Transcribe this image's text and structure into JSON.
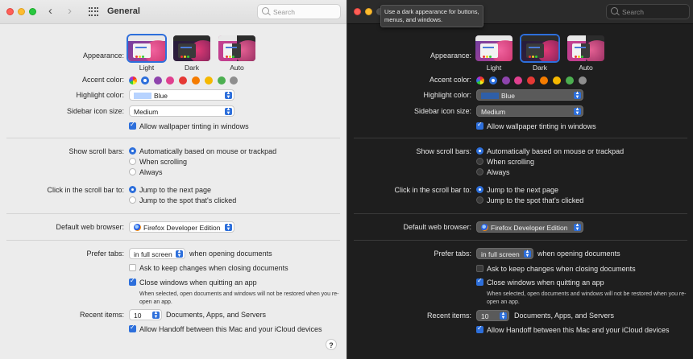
{
  "window": {
    "title": "General",
    "search_placeholder": "Search"
  },
  "tooltip": "Use a dark appearance for buttons, menus, and windows.",
  "appearance": {
    "label": "Appearance:",
    "options": [
      "Light",
      "Dark",
      "Auto"
    ],
    "light_selected": "Light",
    "dark_selected": "Dark"
  },
  "accent_color": {
    "label": "Accent color:",
    "colors": [
      "multicolor",
      "#2d6fdb",
      "#8e44ad",
      "#e0408f",
      "#e53935",
      "#f57c00",
      "#f5b800",
      "#4caf50",
      "#8e8e8e"
    ],
    "selected": "#2d6fdb"
  },
  "highlight_color": {
    "label": "Highlight color:",
    "value": "Blue"
  },
  "sidebar_icon_size": {
    "label": "Sidebar icon size:",
    "value": "Medium"
  },
  "wallpaper_tinting": {
    "label": "Allow wallpaper tinting in windows",
    "checked": true
  },
  "scroll_bars": {
    "label": "Show scroll bars:",
    "options": [
      "Automatically based on mouse or trackpad",
      "When scrolling",
      "Always"
    ],
    "selected": "Automatically based on mouse or trackpad"
  },
  "scroll_click": {
    "label": "Click in the scroll bar to:",
    "options": [
      "Jump to the next page",
      "Jump to the spot that's clicked"
    ],
    "selected": "Jump to the next page"
  },
  "default_browser": {
    "label": "Default web browser:",
    "value": "Firefox Developer Edition"
  },
  "prefer_tabs": {
    "label": "Prefer tabs:",
    "value": "in full screen",
    "suffix": "when opening documents"
  },
  "ask_keep_changes": {
    "label": "Ask to keep changes when closing documents",
    "checked": false
  },
  "close_windows": {
    "label": "Close windows when quitting an app",
    "checked": true,
    "note": "When selected, open documents and windows will not be restored when you re-open an app."
  },
  "recent_items": {
    "label": "Recent items:",
    "value": "10",
    "suffix": "Documents, Apps, and Servers"
  },
  "handoff": {
    "label": "Allow Handoff between this Mac and your iCloud devices",
    "checked": true
  },
  "help": "?"
}
